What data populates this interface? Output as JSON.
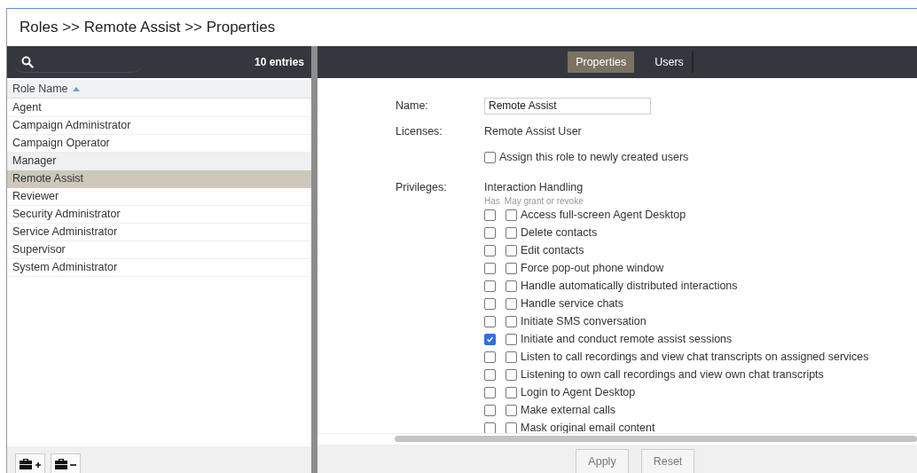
{
  "page_title": "Roles >> Remote Assist >> Properties",
  "left_panel": {
    "entry_count": "10 entries",
    "column_header": "Role Name",
    "roles": [
      {
        "label": "Agent",
        "selected": false,
        "hovered": false
      },
      {
        "label": "Campaign Administrator",
        "selected": false,
        "hovered": false
      },
      {
        "label": "Campaign Operator",
        "selected": false,
        "hovered": false
      },
      {
        "label": "Manager",
        "selected": false,
        "hovered": true
      },
      {
        "label": "Remote Assist",
        "selected": true,
        "hovered": false
      },
      {
        "label": "Reviewer",
        "selected": false,
        "hovered": false
      },
      {
        "label": "Security Administrator",
        "selected": false,
        "hovered": false
      },
      {
        "label": "Service Administrator",
        "selected": false,
        "hovered": false
      },
      {
        "label": "Supervisor",
        "selected": false,
        "hovered": false
      },
      {
        "label": "System Administrator",
        "selected": false,
        "hovered": false
      }
    ]
  },
  "tabs": [
    {
      "label": "Properties",
      "selected": true
    },
    {
      "label": "Users",
      "selected": false
    }
  ],
  "form": {
    "name_label": "Name:",
    "name_value": "Remote Assist",
    "licenses_label": "Licenses:",
    "licenses_value": "Remote Assist User",
    "assign_checkbox": {
      "label": "Assign this role to newly created users",
      "checked": false
    },
    "privileges_label": "Privileges:",
    "group_title": "Interaction Handling",
    "has_header": "Has",
    "grant_header": "May grant or revoke",
    "privileges": [
      {
        "label": "Access full-screen Agent Desktop",
        "has": false,
        "may_grant": false
      },
      {
        "label": "Delete contacts",
        "has": false,
        "may_grant": false
      },
      {
        "label": "Edit contacts",
        "has": false,
        "may_grant": false
      },
      {
        "label": "Force pop-out phone window",
        "has": false,
        "may_grant": false
      },
      {
        "label": "Handle automatically distributed interactions",
        "has": false,
        "may_grant": false
      },
      {
        "label": "Handle service chats",
        "has": false,
        "may_grant": false
      },
      {
        "label": "Initiate SMS conversation",
        "has": false,
        "may_grant": false
      },
      {
        "label": "Initiate and conduct remote assist sessions",
        "has": true,
        "may_grant": false
      },
      {
        "label": "Listen to call recordings and view chat transcripts on assigned services",
        "has": false,
        "may_grant": false
      },
      {
        "label": "Listening to own call recordings and view own chat transcripts",
        "has": false,
        "may_grant": false
      },
      {
        "label": "Login to Agent Desktop",
        "has": false,
        "may_grant": false
      },
      {
        "label": "Make external calls",
        "has": false,
        "may_grant": false
      },
      {
        "label": "Mask original email content",
        "has": false,
        "may_grant": false
      }
    ]
  },
  "buttons": [
    "Apply",
    "Reset"
  ]
}
